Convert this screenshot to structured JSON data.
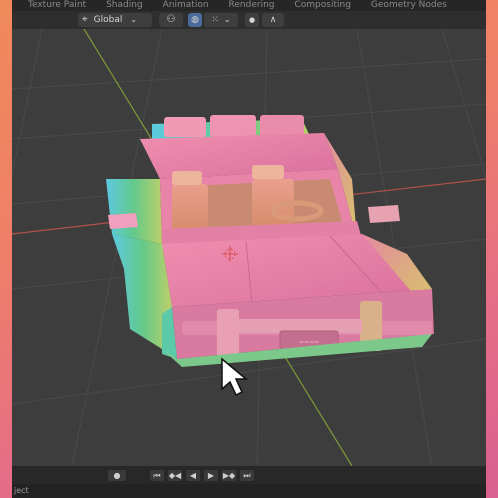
{
  "workspace_tabs": [
    "Texture Paint",
    "Shading",
    "Animation",
    "Rendering",
    "Compositing",
    "Geometry Nodes"
  ],
  "header": {
    "transform_orientation": "Global",
    "icons": [
      "transform-orientation-icon",
      "chevron-down-icon",
      "pivot-link-icon",
      "snap-magnet-icon",
      "snap-grid-icon",
      "proportional-edit-icon",
      "falloff-curve-icon"
    ]
  },
  "viewport": {
    "object": "low-poly police car",
    "shading": "normal map colors"
  },
  "playback": {
    "buttons": [
      "jump-start",
      "prev-keyframe",
      "play-reverse",
      "play",
      "next-keyframe",
      "jump-end"
    ],
    "glyphs": [
      "⏮",
      "◆◀",
      "◀",
      "▶",
      "▶◆",
      "⏭"
    ]
  },
  "status_bar": {
    "text": "ject"
  },
  "colors": {
    "accent": "#4c6a9a",
    "grid": "#4a4a4a",
    "axis_x": "#b0524a",
    "axis_y": "#7c9a3a",
    "car_pink": "#e880a8",
    "car_cyan": "#58c9d6",
    "car_yellow": "#d7c25a"
  }
}
